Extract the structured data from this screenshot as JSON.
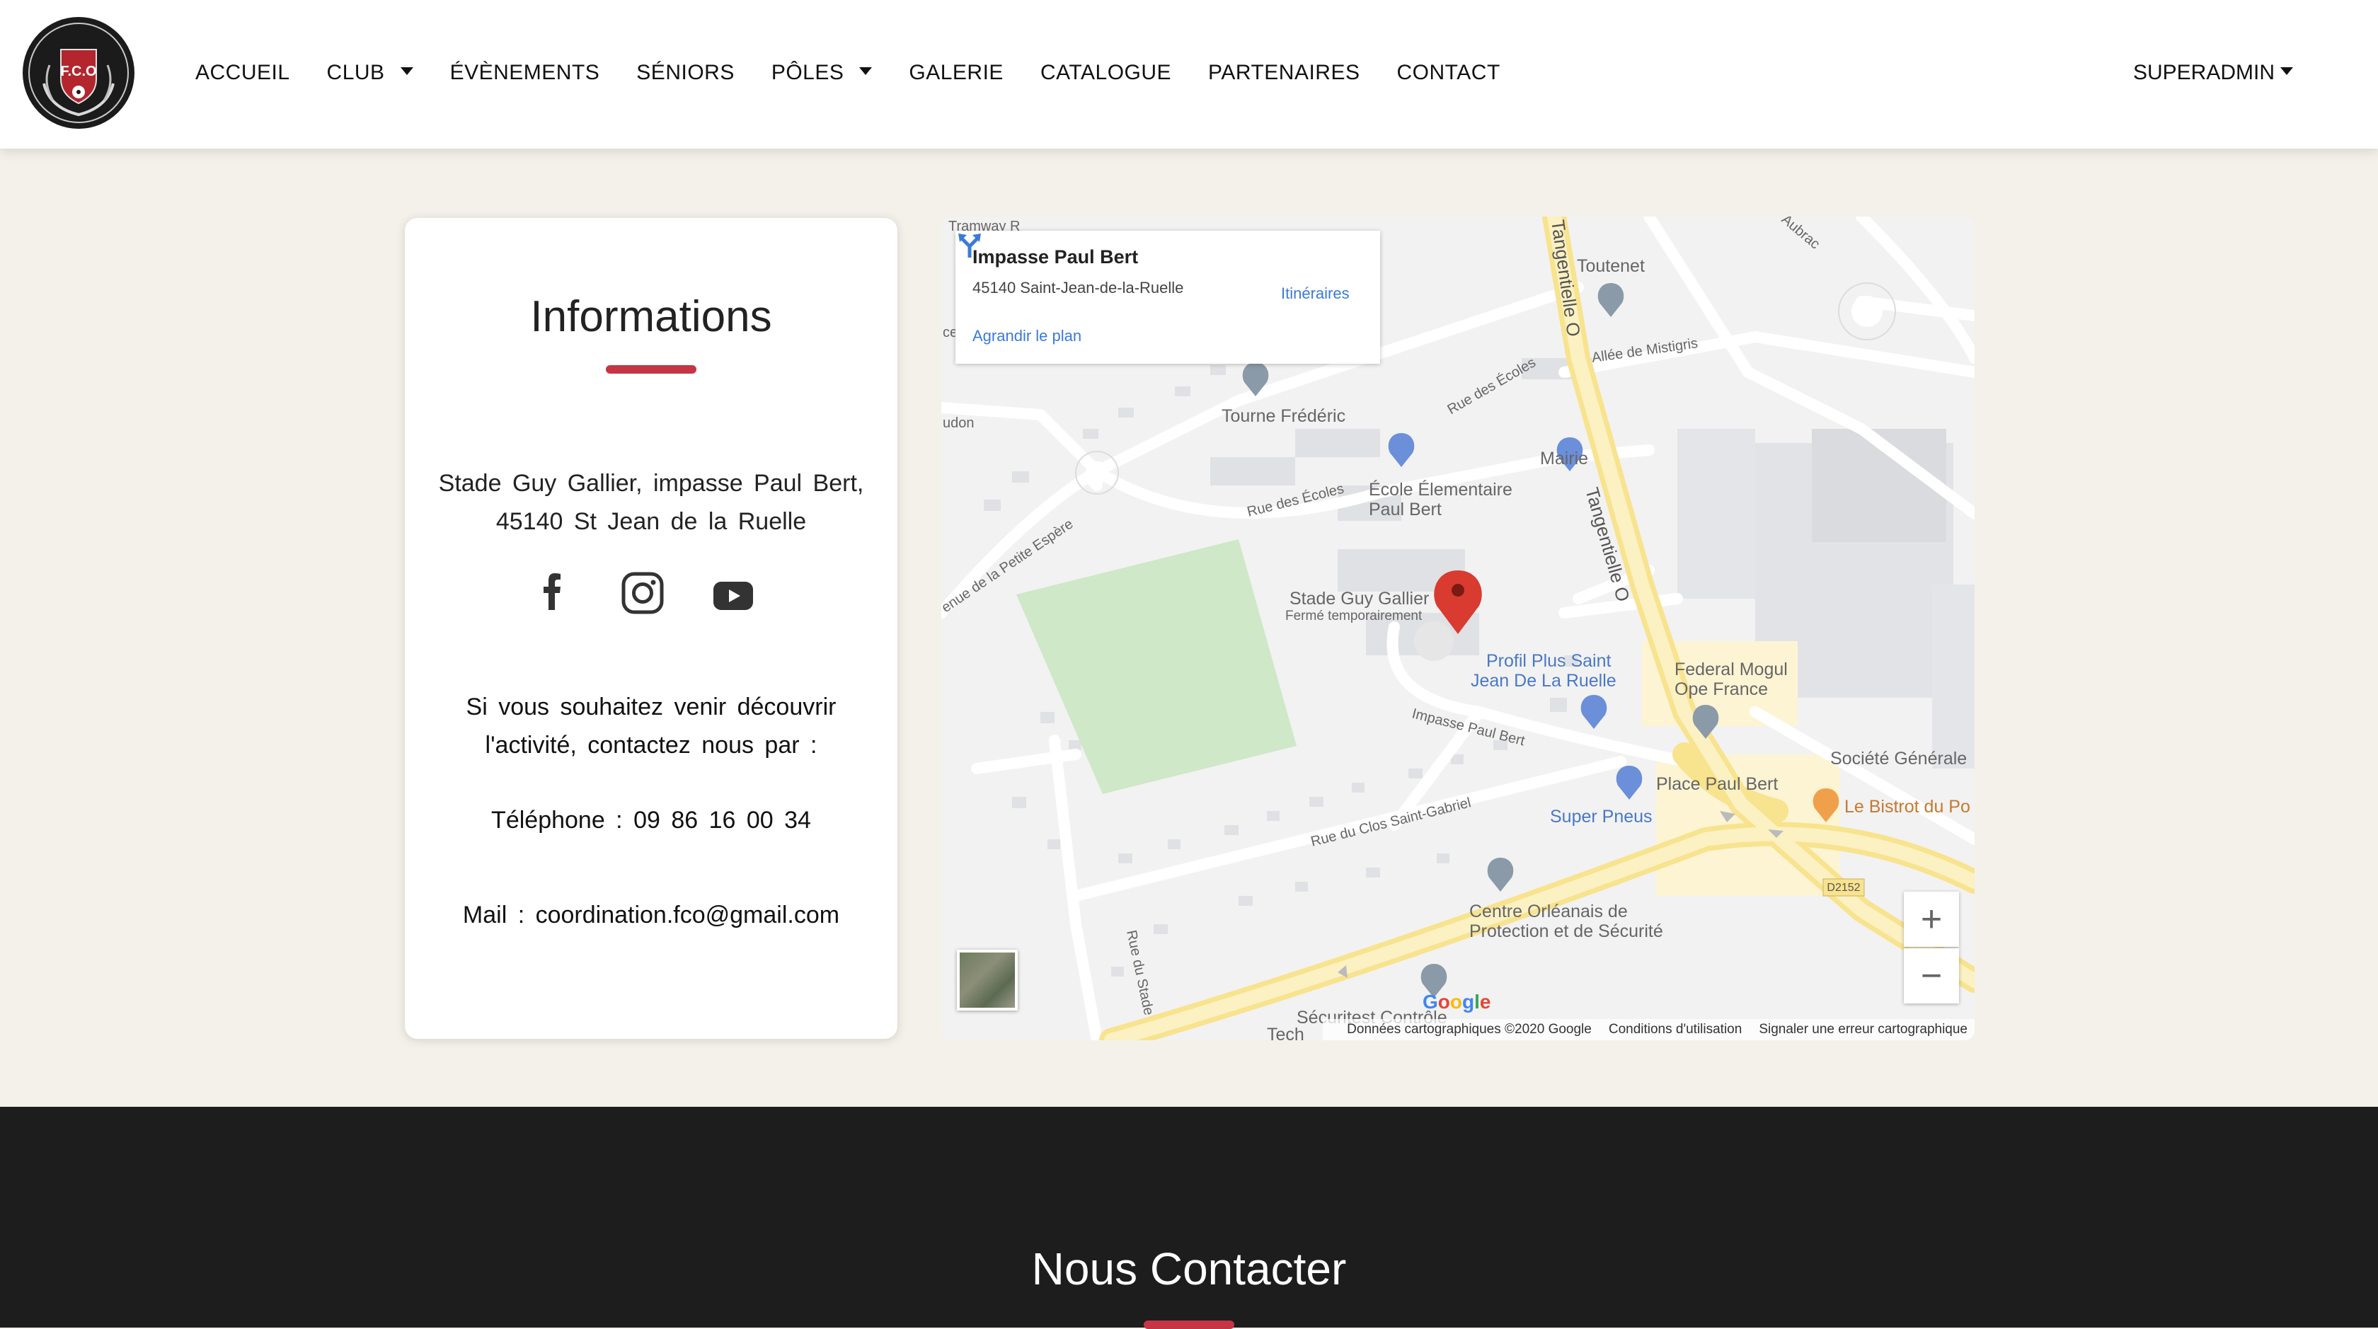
{
  "nav": {
    "logo_text": "F.C.O",
    "items": [
      {
        "label": "ACCUEIL"
      },
      {
        "label": "CLUB"
      },
      {
        "label": "ÉVÈNEMENTS"
      },
      {
        "label": "SÉNIORS"
      },
      {
        "label": "PÔLES"
      },
      {
        "label": "GALERIE"
      },
      {
        "label": "CATALOGUE"
      },
      {
        "label": "PARTENAIRES"
      },
      {
        "label": "CONTACT"
      }
    ],
    "user": "SUPERADMIN"
  },
  "info": {
    "title": "Informations",
    "address_line1": "Stade Guy Gallier, impasse Paul Bert,",
    "address_line2": "45140 St Jean de la Ruelle",
    "social_icons": [
      "facebook-icon",
      "instagram-icon",
      "youtube-icon"
    ],
    "invite_line1": "Si vous souhaitez venir découvrir",
    "invite_line2": "l'activité, contactez nous par :",
    "phone": "Téléphone : 09 86 16 00 34",
    "mail": "Mail : coordination.fco@gmail.com"
  },
  "map": {
    "card_title": "Impasse Paul Bert",
    "card_address": "45140 Saint-Jean-de-la-Ruelle",
    "card_link": "Agrandir le plan",
    "directions": "Itinéraires",
    "labels": {
      "toutenet": "Toutenet",
      "tourne": "Tourne Frédéric",
      "mairie": "Mairie",
      "ecole1": "École Élementaire",
      "ecole2": "Paul Bert",
      "stade": "Stade Guy Gallier",
      "ferme": "Fermé temporairement",
      "profil1": "Profil Plus Saint",
      "profil2": "Jean De La Ruelle",
      "federal1": "Federal Mogul",
      "federal2": "Ope France",
      "societe": "Société Générale",
      "place": "Place Paul Bert",
      "bistrot": "Le Bistrot du Po",
      "superpneus": "Super Pneus",
      "centre1": "Centre Orléanais de",
      "centre2": "Protection et de Sécurité",
      "securitest": "Sécuritest Contrôle",
      "tech": "Tech",
      "tangentielle": "Tangentielle O",
      "allee": "Allée de Mistigris",
      "rue_ecoles": "Rue des Écoles",
      "rue_ecoles2": "Rue des Écoles",
      "petite_espere": "enue de la Petite Espère",
      "impasse": "Impasse Paul Bert",
      "clos": "Rue du Clos Saint-Gabriel",
      "rue_stade": "Rue du Stade",
      "aubrac": "Aubrac",
      "d2152": "D2152",
      "udon": "udon",
      "tramway": "Tramway R",
      "ce": "ce"
    },
    "footer_data": "Données cartographiques ©2020 Google",
    "footer_terms": "Conditions d'utilisation",
    "footer_report": "Signaler une erreur cartographique",
    "google": "Google",
    "zoom_in": "+",
    "zoom_out": "−"
  },
  "footer": {
    "title": "Nous Contacter"
  },
  "colors": {
    "accent": "#c53545",
    "page_bg": "#f4f1ea",
    "footer_bg": "#1d1d1d",
    "map_road_main": "#fbe9a3"
  }
}
